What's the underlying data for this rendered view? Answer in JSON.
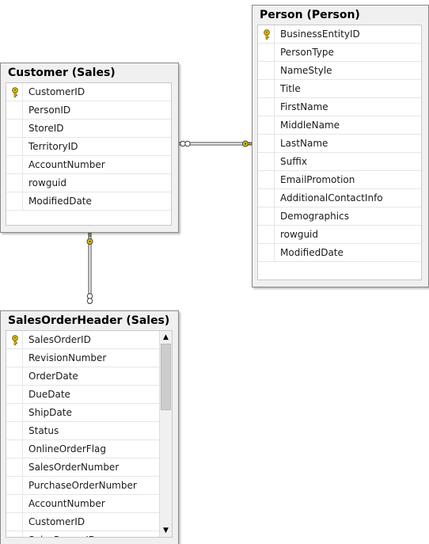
{
  "tables": {
    "person": {
      "title": "Person (Person)",
      "columns": [
        "BusinessEntityID",
        "PersonType",
        "NameStyle",
        "Title",
        "FirstName",
        "MiddleName",
        "LastName",
        "Suffix",
        "EmailPromotion",
        "AdditionalContactInfo",
        "Demographics",
        "rowguid",
        "ModifiedDate"
      ]
    },
    "customer": {
      "title": "Customer (Sales)",
      "columns": [
        "CustomerID",
        "PersonID",
        "StoreID",
        "TerritoryID",
        "AccountNumber",
        "rowguid",
        "ModifiedDate"
      ]
    },
    "sales_order_header": {
      "title": "SalesOrderHeader (Sales)",
      "columns": [
        "SalesOrderID",
        "RevisionNumber",
        "OrderDate",
        "DueDate",
        "ShipDate",
        "Status",
        "OnlineOrderFlag",
        "SalesOrderNumber",
        "PurchaseOrderNumber",
        "AccountNumber",
        "CustomerID",
        "SalesPersonID"
      ]
    }
  },
  "relationships": [
    {
      "from": "customer",
      "to": "person",
      "one_side": "person",
      "many_side": "customer"
    },
    {
      "from": "sales_order_header",
      "to": "customer",
      "one_side": "customer",
      "many_side": "sales_order_header"
    }
  ],
  "icons": {
    "primary_key": "key-icon",
    "scroll_up": "scroll-up-arrow-icon",
    "scroll_down": "scroll-down-arrow-icon"
  },
  "colors": {
    "key": "#e8c800",
    "relationship_line": "#404040",
    "header_bg": "#f0f0f0"
  }
}
